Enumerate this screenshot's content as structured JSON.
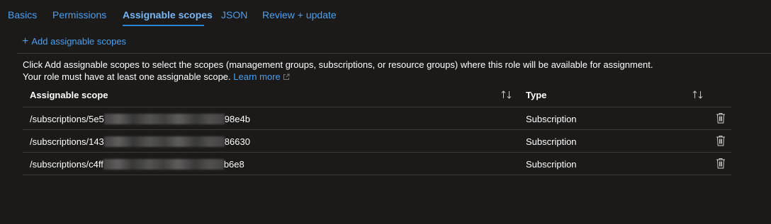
{
  "tabs": [
    {
      "label": "Basics"
    },
    {
      "label": "Permissions"
    },
    {
      "label": "Assignable scopes"
    },
    {
      "label": "JSON"
    },
    {
      "label": "Review + update"
    }
  ],
  "toolbar": {
    "add_label": "Add assignable scopes"
  },
  "description": {
    "line1": "Click Add assignable scopes to select the scopes (management groups, subscriptions, or resource groups) where this role will be available for assignment.",
    "line2": "Your role must have at least one assignable scope.",
    "learn_more": "Learn more"
  },
  "table": {
    "columns": [
      "Assignable scope",
      "Type"
    ],
    "rows": [
      {
        "scope_prefix": "/subscriptions/5e5",
        "scope_suffix": "98e4b",
        "type": "Subscription"
      },
      {
        "scope_prefix": "/subscriptions/143",
        "scope_suffix": "86630",
        "type": "Subscription"
      },
      {
        "scope_prefix": "/subscriptions/c4ff",
        "scope_suffix": "b6e8",
        "type": "Subscription"
      }
    ]
  },
  "colors": {
    "accent": "#4aa0f0",
    "background": "#1b1a19",
    "divider": "#3b3a39"
  },
  "icons": {
    "sort": "sort-icon",
    "delete": "trash-icon",
    "external": "external-link-icon",
    "add": "plus-icon"
  }
}
